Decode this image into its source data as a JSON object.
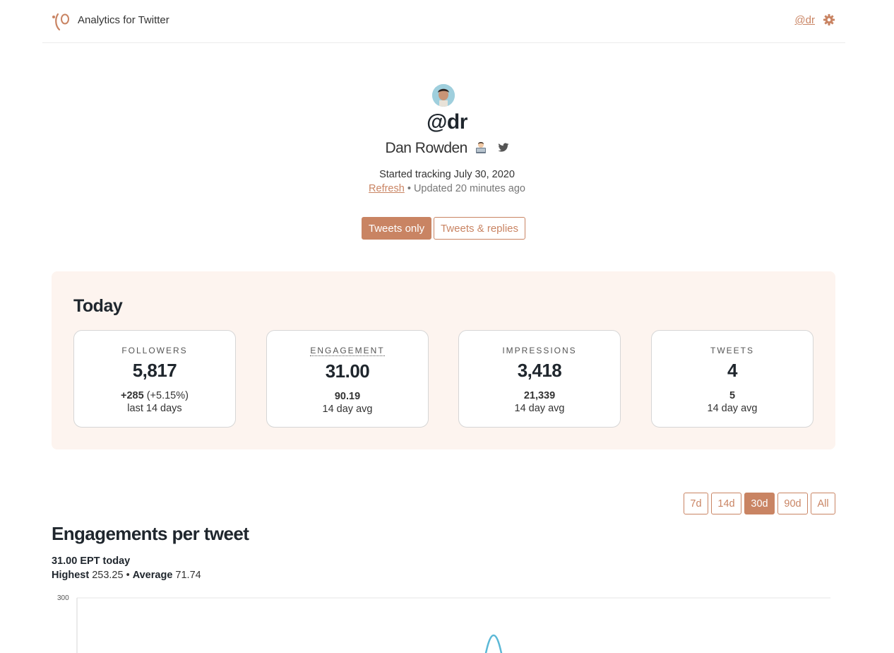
{
  "header": {
    "app_title": "Analytics for Twitter",
    "handle": "@dr",
    "logo_icon": "tweet-logo-icon",
    "settings_icon": "gear-icon"
  },
  "profile": {
    "handle": "@dr",
    "name": "Dan Rowden",
    "emoji_icon": "technologist-emoji-icon",
    "twitter_icon": "twitter-bird-icon",
    "tracking": "Started tracking July 30, 2020",
    "refresh_label": "Refresh",
    "updated": " • Updated 20 minutes ago"
  },
  "filters": {
    "tweets_only": "Tweets only",
    "tweets_replies": "Tweets & replies",
    "active": "Tweets only"
  },
  "today": {
    "title": "Today",
    "cards": [
      {
        "label": "FOLLOWERS",
        "value": "5,817",
        "sub_bold": "+285",
        "sub_rest": " (+5.15%)",
        "sub2": "last 14 days"
      },
      {
        "label": "ENGAGEMENT",
        "value": "31.00",
        "sub_bold": "90.19",
        "sub_rest": "",
        "sub2": "14 day avg"
      },
      {
        "label": "IMPRESSIONS",
        "value": "3,418",
        "sub_bold": "21,339",
        "sub_rest": "",
        "sub2": "14 day avg"
      },
      {
        "label": "TWEETS",
        "value": "4",
        "sub_bold": "5",
        "sub_rest": "",
        "sub2": "14 day avg"
      }
    ]
  },
  "ranges": {
    "items": [
      "7d",
      "14d",
      "30d",
      "90d",
      "All"
    ],
    "active": "30d"
  },
  "ept": {
    "title": "Engagements per tweet",
    "today": "31.00 EPT today",
    "highest_label": "Highest",
    "highest_value": " 253.25 • ",
    "average_label": "Average",
    "average_value": " 71.74"
  },
  "colors": {
    "accent": "#c98463",
    "panel_bg": "#fdf4ef",
    "line": "#5bb8d6"
  },
  "chart_data": {
    "type": "line",
    "title": "Engagements per tweet",
    "ylim": [
      0,
      300
    ],
    "y_ticks": [
      "300"
    ],
    "series": [
      {
        "values": [
          253.25
        ]
      }
    ]
  }
}
